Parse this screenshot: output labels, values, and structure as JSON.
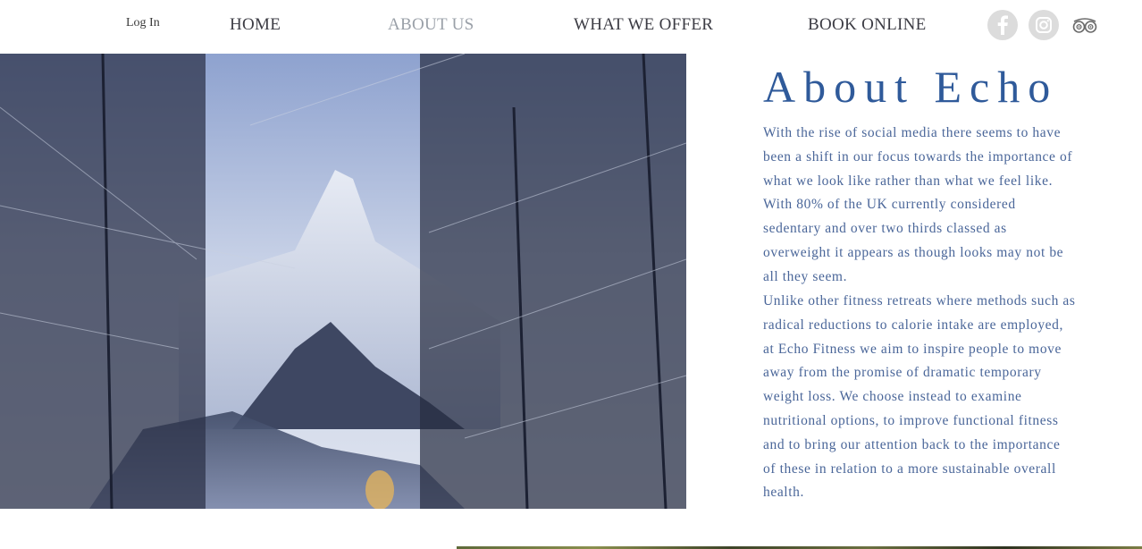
{
  "header": {
    "login_label": "Log In",
    "nav": [
      {
        "label": "HOME",
        "active": false
      },
      {
        "label": "ABOUT US",
        "active": true
      },
      {
        "label": "WHAT WE OFFER",
        "active": false
      },
      {
        "label": "BOOK ONLINE",
        "active": false
      }
    ],
    "social": [
      {
        "name": "facebook-icon"
      },
      {
        "name": "instagram-icon"
      },
      {
        "name": "tripadvisor-icon"
      }
    ]
  },
  "hero_image": {
    "alt": "Snowy forest framing a mountain peak at dusk"
  },
  "about": {
    "title": "About Echo",
    "paragraphs": [
      "With the rise of social media there seems to have been a shift in our focus towards the importance of what we look like rather than what we feel like. With 80% of the UK currently considered sedentary and over two thirds classed as overweight it appears as though looks may not be all they seem.",
      "Unlike other fitness retreats where methods such as radical reductions to calorie intake are employed, at Echo Fitness we aim to inspire people to move away from the promise of dramatic temporary weight loss. We choose instead to examine nutritional options, to improve functional fitness and to bring our attention back to the importance of these in relation to a more sustainable overall health."
    ]
  },
  "colors": {
    "title": "#2f5a9a",
    "body_text": "#4a6699",
    "nav_text": "#3c3c44",
    "nav_active": "#9aa0a8",
    "social_bg": "#dcdcdc"
  }
}
